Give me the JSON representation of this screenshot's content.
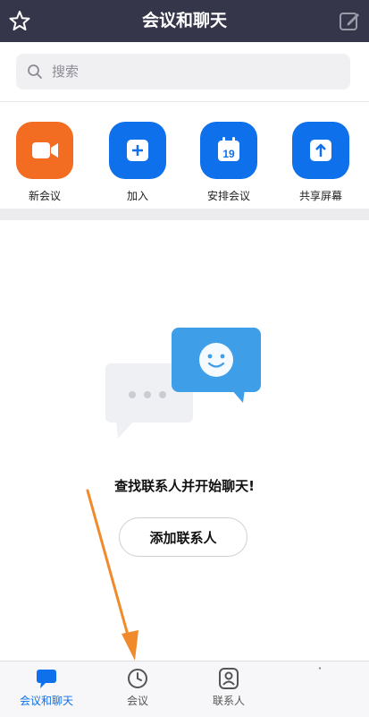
{
  "header": {
    "title": "会议和聊天",
    "left_icon": "star-icon",
    "right_icon": "edit-icon"
  },
  "search": {
    "placeholder": "搜索"
  },
  "actions": [
    {
      "label": "新会议",
      "icon": "video-camera-icon",
      "color": "#f26d21"
    },
    {
      "label": "加入",
      "icon": "plus-icon",
      "color": "#0e71eb"
    },
    {
      "label": "安排会议",
      "icon": "calendar-icon",
      "color": "#0e71eb",
      "calendar_day": "19"
    },
    {
      "label": "共享屏幕",
      "icon": "share-upload-icon",
      "color": "#0e71eb"
    }
  ],
  "empty_state": {
    "message": "查找联系人并开始聊天!",
    "button_label": "添加联系人"
  },
  "tabbar": {
    "items": [
      {
        "label": "会议和聊天",
        "icon": "chat-bubble-icon",
        "active": true
      },
      {
        "label": "会议",
        "icon": "clock-icon",
        "active": false
      },
      {
        "label": "联系人",
        "icon": "contacts-icon",
        "active": false
      }
    ]
  },
  "colors": {
    "header": "#36364a",
    "accent": "#0e71eb",
    "orange": "#f26d21",
    "annotation_arrow": "#f08a2a"
  }
}
